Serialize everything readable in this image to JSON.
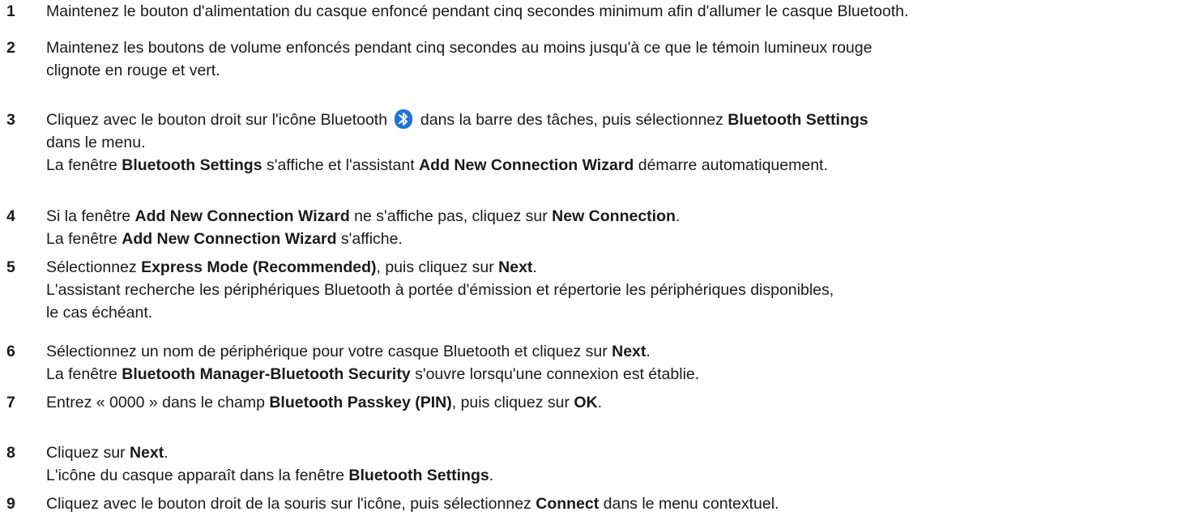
{
  "steps": [
    {
      "number": "1",
      "lines": [
        [
          {
            "t": "Maintenez le bouton d'alimentation du casque enfoncé pendant cinq secondes minimum afin d'allumer le casque Bluetooth."
          }
        ]
      ]
    },
    {
      "number": "2",
      "lines": [
        [
          {
            "t": "Maintenez les boutons de volume enfoncés pendant cinq secondes au moins jusqu'à ce que le témoin lumineux rouge"
          }
        ],
        [
          {
            "t": "clignote en rouge et vert."
          }
        ]
      ]
    },
    {
      "number": "3",
      "lines": [
        [
          {
            "t": "Cliquez avec le bouton droit sur l'icône Bluetooth "
          },
          {
            "icon": "bluetooth-icon"
          },
          {
            "t": " dans la barre des tâches, puis sélectionnez "
          },
          {
            "t": "Bluetooth Settings",
            "b": true
          }
        ],
        [
          {
            "t": "dans le menu."
          }
        ],
        [
          {
            "t": "La fenêtre "
          },
          {
            "t": "Bluetooth Settings",
            "b": true
          },
          {
            "t": " s'affiche et l'assistant "
          },
          {
            "t": "Add New Connection Wizard",
            "b": true
          },
          {
            "t": " démarre automatiquement."
          }
        ]
      ]
    },
    {
      "number": "4",
      "lines": [
        [
          {
            "t": "Si la fenêtre "
          },
          {
            "t": "Add New Connection Wizard",
            "b": true
          },
          {
            "t": " ne s'affiche pas, cliquez sur "
          },
          {
            "t": "New Connection",
            "b": true
          },
          {
            "t": "."
          }
        ],
        [
          {
            "t": "La fenêtre "
          },
          {
            "t": "Add New Connection Wizard",
            "b": true
          },
          {
            "t": " s'affiche."
          }
        ]
      ]
    },
    {
      "number": "5",
      "lines": [
        [
          {
            "t": "Sélectionnez "
          },
          {
            "t": "Express Mode (Recommended)",
            "b": true
          },
          {
            "t": ", puis cliquez sur "
          },
          {
            "t": "Next",
            "b": true
          },
          {
            "t": "."
          }
        ],
        [
          {
            "t": "L'assistant recherche les périphériques Bluetooth à portée d'émission et répertorie les périphériques disponibles,"
          }
        ],
        [
          {
            "t": "le cas échéant."
          }
        ]
      ]
    },
    {
      "number": "6",
      "lines": [
        [
          {
            "t": "Sélectionnez un nom de périphérique pour votre casque Bluetooth et cliquez sur "
          },
          {
            "t": "Next",
            "b": true
          },
          {
            "t": "."
          }
        ],
        [
          {
            "t": "La fenêtre "
          },
          {
            "t": "Bluetooth Manager-Bluetooth Security",
            "b": true
          },
          {
            "t": " s'ouvre lorsqu'une connexion est établie."
          }
        ]
      ]
    },
    {
      "number": "7",
      "lines": [
        [
          {
            "t": "Entrez « 0000 » dans le champ "
          },
          {
            "t": "Bluetooth Passkey (PIN)",
            "b": true
          },
          {
            "t": ", puis cliquez sur "
          },
          {
            "t": "OK",
            "b": true
          },
          {
            "t": "."
          }
        ]
      ]
    },
    {
      "number": "8",
      "lines": [
        [
          {
            "t": "Cliquez sur "
          },
          {
            "t": "Next",
            "b": true
          },
          {
            "t": "."
          }
        ],
        [
          {
            "t": "L'icône du casque apparaît dans la fenêtre "
          },
          {
            "t": "Bluetooth Settings",
            "b": true
          },
          {
            "t": "."
          }
        ]
      ]
    },
    {
      "number": "9",
      "lines": [
        [
          {
            "t": "Cliquez avec le bouton droit de la souris sur l'icône, puis sélectionnez "
          },
          {
            "t": "Connect",
            "b": true
          },
          {
            "t": " dans le menu contextuel."
          }
        ]
      ]
    }
  ],
  "colors": {
    "text": "#1a1a1a",
    "bluetooth_icon_bg": "#1f74d6",
    "bluetooth_icon_fg": "#ffffff"
  }
}
